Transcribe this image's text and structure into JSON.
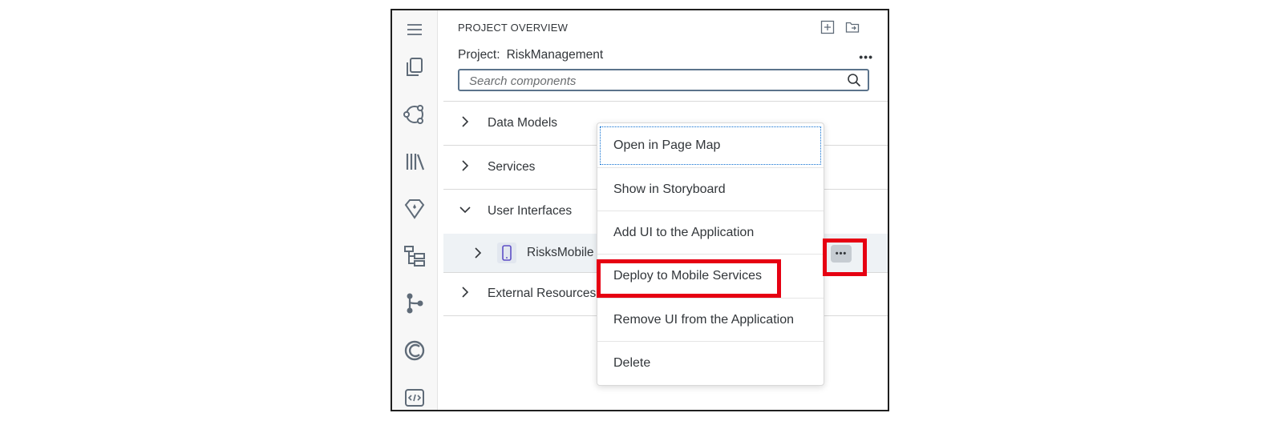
{
  "panel": {
    "title": "PROJECT OVERVIEW",
    "project_label": "Project:",
    "project_name": "RiskManagement",
    "more_label": "•••",
    "search_placeholder": "Search components"
  },
  "activity_bar": {
    "icons": [
      "menu-icon",
      "explorer-icon",
      "integration-icon",
      "library-icon",
      "gem-icon",
      "hierarchy-icon",
      "source-control-icon",
      "circles-icon",
      "code-icon"
    ]
  },
  "tree": [
    {
      "label": "Data Models",
      "expanded": false
    },
    {
      "label": "Services",
      "expanded": false
    },
    {
      "label": "User Interfaces",
      "expanded": true,
      "children": [
        {
          "label": "RisksMobile"
        }
      ]
    },
    {
      "label": "External Resources",
      "expanded": false
    }
  ],
  "context_menu": {
    "items": [
      "Open in Page Map",
      "Show in Storyboard",
      "Add UI to the Application",
      "Deploy to Mobile Services",
      "Remove UI from the Application",
      "Delete"
    ]
  },
  "row_more_label": "•••",
  "colors": {
    "highlight": "#e60012",
    "search_border": "#5b738b",
    "device_icon": "#5d4fc6",
    "selected_row": "#eef2f5"
  }
}
